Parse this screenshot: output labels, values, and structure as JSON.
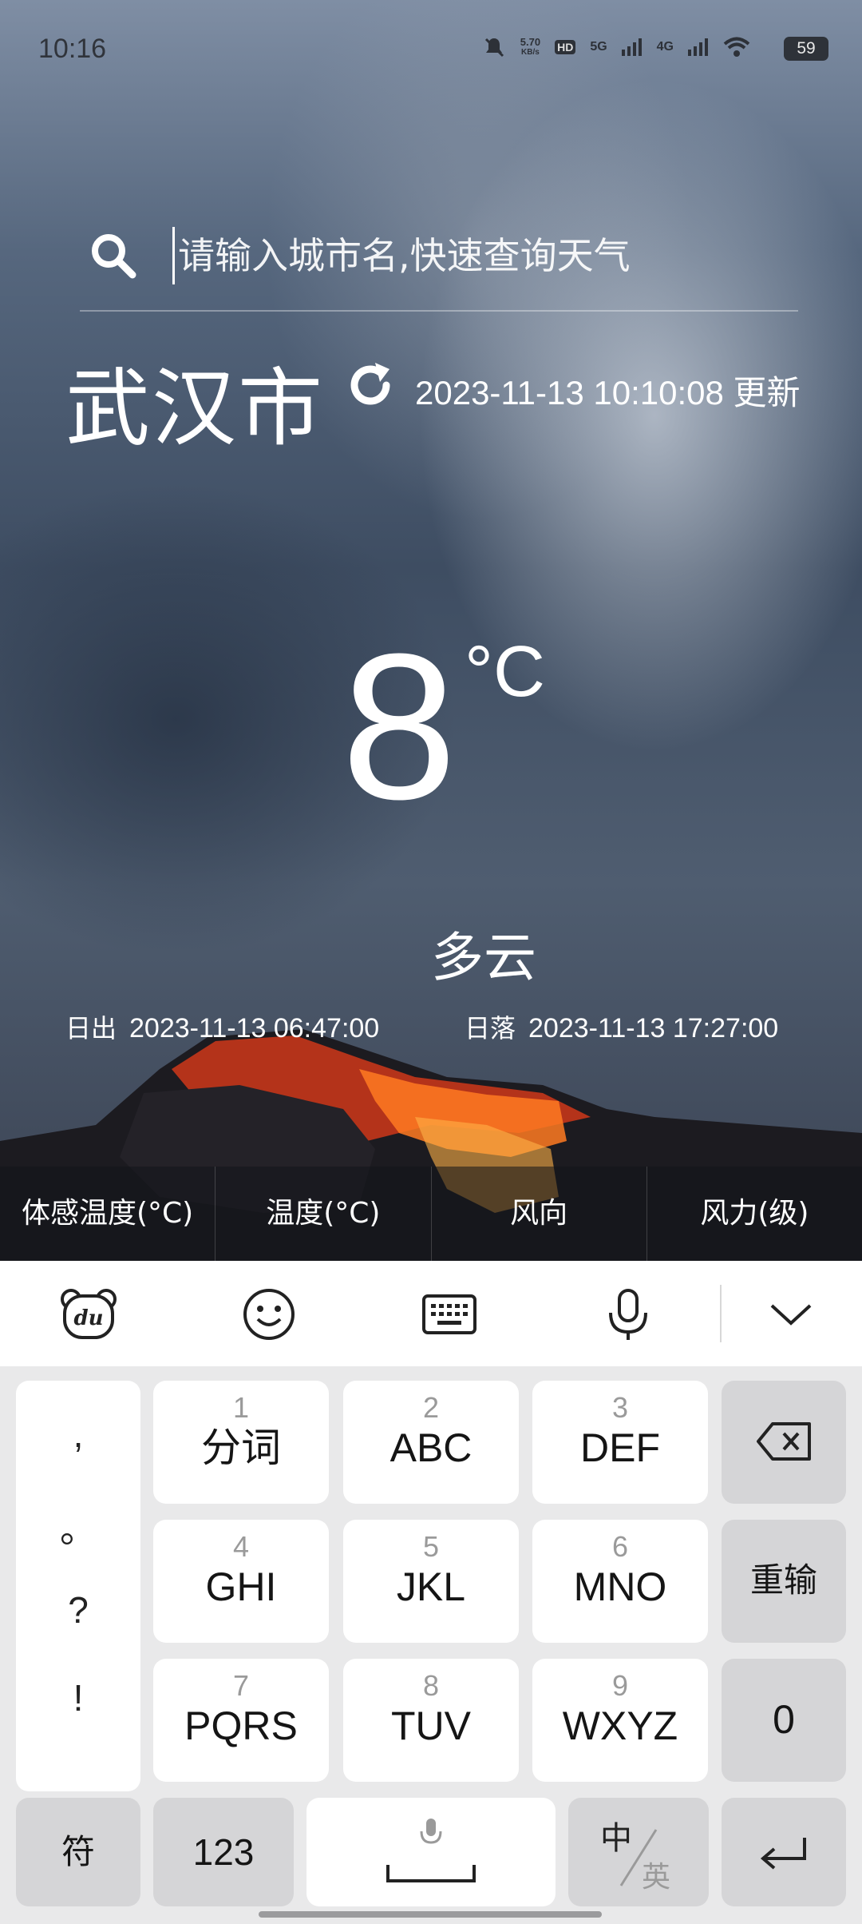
{
  "status_bar": {
    "time": "10:16",
    "net_speed": "5.70",
    "net_unit": "KB/s",
    "hd": "HD",
    "sig1": "5G",
    "sig2": "4G",
    "battery": "59"
  },
  "search": {
    "placeholder": "请输入城市名,快速查询天气"
  },
  "weather": {
    "city": "武汉市",
    "update_time": "2023-11-13 10:10:08 更新",
    "temperature": "8",
    "unit": "°C",
    "condition": "多云",
    "sunrise_label": "日出",
    "sunrise": "2023-11-13 06:47:00",
    "sunset_label": "日落",
    "sunset": "2023-11-13 17:27:00"
  },
  "details": {
    "headers": [
      "体感温度(°C)",
      "温度(°C)",
      "风向",
      "风力(级)"
    ]
  },
  "keyboard": {
    "punct": [
      ",",
      "。",
      "?",
      "!"
    ],
    "keys": [
      {
        "num": "1",
        "letters": "分词"
      },
      {
        "num": "2",
        "letters": "ABC"
      },
      {
        "num": "3",
        "letters": "DEF"
      },
      {
        "num": "4",
        "letters": "GHI"
      },
      {
        "num": "5",
        "letters": "JKL"
      },
      {
        "num": "6",
        "letters": "MNO"
      },
      {
        "num": "7",
        "letters": "PQRS"
      },
      {
        "num": "8",
        "letters": "TUV"
      },
      {
        "num": "9",
        "letters": "WXYZ"
      }
    ],
    "retype": "重输",
    "zero": "0",
    "symbol": "符",
    "numeric": "123",
    "lang_cn": "中",
    "lang_en": "英"
  },
  "colors": {
    "accent": "#ffffff",
    "keyboard_bg": "#e9e9ea",
    "key_grey": "#d5d5d7"
  },
  "icons": [
    "search-icon",
    "refresh-icon",
    "baidu-logo-icon",
    "emoji-icon",
    "keyboard-icon",
    "mic-icon",
    "chevron-down-icon",
    "backspace-icon",
    "enter-icon"
  ]
}
